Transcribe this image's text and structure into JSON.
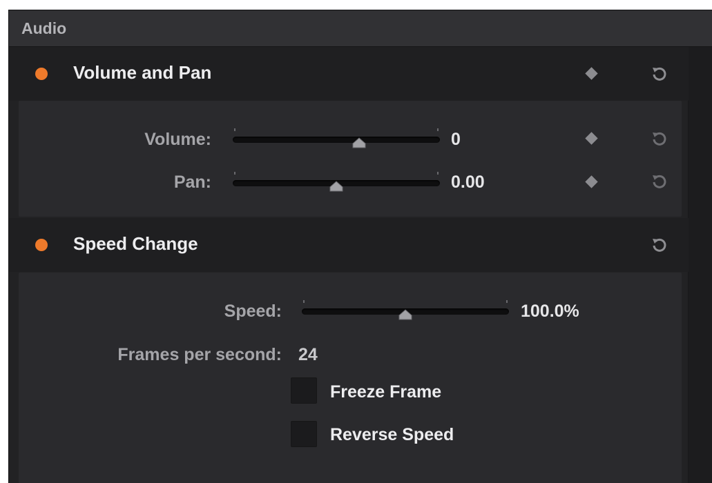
{
  "panel": {
    "title": "Audio"
  },
  "sections": [
    {
      "title": "Volume and Pan",
      "enabled_color": "#ee7a2b",
      "controls": [
        {
          "label": "Volume:",
          "value": "0",
          "slider_fraction": 0.61
        },
        {
          "label": "Pan:",
          "value": "0.00",
          "slider_fraction": 0.5
        }
      ]
    },
    {
      "title": "Speed Change",
      "enabled_color": "#ee7a2b",
      "speed": {
        "label": "Speed:",
        "value": "100.0%",
        "slider_fraction": 0.5
      },
      "fps": {
        "label": "Frames per second:",
        "value": "24"
      },
      "checkboxes": [
        {
          "label": "Freeze Frame",
          "checked": false
        },
        {
          "label": "Reverse Speed",
          "checked": false
        }
      ]
    }
  ],
  "icons": {
    "keyframe": "keyframe-diamond-icon",
    "reset": "reset-arrow-icon"
  }
}
